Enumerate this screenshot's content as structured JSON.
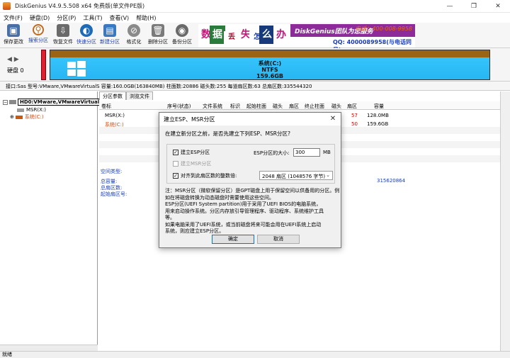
{
  "window": {
    "title": "DiskGenius V4.9.5.508 x64 免费版(单文件PE版)",
    "controls": [
      "—",
      "❐",
      "✕"
    ]
  },
  "menu": [
    "文件(F)",
    "硬盘(D)",
    "分区(P)",
    "工具(T)",
    "查看(V)",
    "帮助(H)"
  ],
  "toolbar": [
    {
      "label": "保存更改",
      "icon": "save-icon",
      "color": "#4a6fa5"
    },
    {
      "label": "搜索分区",
      "icon": "search-icon",
      "color": "#c06a20"
    },
    {
      "label": "恢复文件",
      "icon": "recover-icon",
      "color": "#6a6a6a"
    },
    {
      "label": "快速分区",
      "icon": "quick-partition-icon",
      "color": "#1d6ab8"
    },
    {
      "label": "新建分区",
      "icon": "new-partition-icon",
      "color": "#3a78c0"
    },
    {
      "label": "格式化",
      "icon": "format-icon",
      "color": "#8a8a8a"
    },
    {
      "label": "删除分区",
      "icon": "delete-icon",
      "color": "#7a7a7a"
    },
    {
      "label": "备份分区",
      "icon": "backup-icon",
      "color": "#6a6a6a"
    }
  ],
  "banner": {
    "chars": [
      "数",
      "据",
      "丢",
      "失",
      "怎",
      "么",
      "办",
      "!"
    ],
    "brand": "DiskGenius团队为您服务",
    "phone": "电话：400-008-9958",
    "qq": "QQ: 4000089958(与电话同号)"
  },
  "disk": {
    "label": "硬盘 0",
    "partition_name": "系统(C:)",
    "partition_fs": "NTFS",
    "partition_size": "159.6GB",
    "info": "接口:Sas  型号:VMware,VMwareVirtualS  容量:160.0GB(163840MB)  柱面数:20886  磁头数:255  每道扇区数:63  总扇区数:335544320"
  },
  "tree": {
    "disk": "HD0:VMware,VMwareVirtualS",
    "items": [
      "MSR(X:)",
      "系统(C:)"
    ]
  },
  "tabs": [
    "分区参数",
    "浏览文件"
  ],
  "grid": {
    "headers": [
      "卷标",
      "序号(状态)",
      "文件系统",
      "标识",
      "起始柱面",
      "磁头",
      "扇区",
      "终止柱面",
      "磁头",
      "扇区",
      "容量"
    ],
    "rows": [
      {
        "name": "MSR(X:)",
        "sector": "57",
        "capacity": "128.0MB"
      },
      {
        "name": "系统(C:)",
        "sector": "50",
        "capacity": "159.6GB"
      }
    ]
  },
  "detail": {
    "type_label": "空间类型:",
    "total_label": "总容量:",
    "total_sectors_label": "总扇区数:",
    "start_sector_label": "起始扇区号:",
    "right_value": "315620864"
  },
  "dialog": {
    "title": "建立ESP、MSR分区",
    "prompt": "在建立新分区之前，是否先建立下列ESP、MSR分区?",
    "esp_label": "建立ESP分区",
    "esp_checked": "☑",
    "esp_size_label": "ESP分区的大小:",
    "esp_size_value": "300",
    "esp_size_unit": "MB",
    "msr_label": "建立MSR分区",
    "align_label": "对齐到此扇区数的整数倍:",
    "align_value": "2048 扇区 (1048576 字节)",
    "note": [
      "注：MSR分区（微软保留分区）是GPT磁盘上用于保留空间以供备用的分区。例",
      "如在将磁盘转换为动态磁盘时需要使用这些空间。",
      "    ESP分区(UEFI System partition)用于采用了UEFI BIOS的电脑系统，",
      "用来启动操作系统。分区内存放引导管理程序、驱动程序、系统维护工具",
      "等。",
      "    如果电脑采用了UEFI系统，或当前磁盘将来可能会用在UEFI系统上启动",
      "系统，则应建立ESP分区。"
    ],
    "ok_label": "确定",
    "cancel_label": "取消"
  },
  "status": "就绪"
}
